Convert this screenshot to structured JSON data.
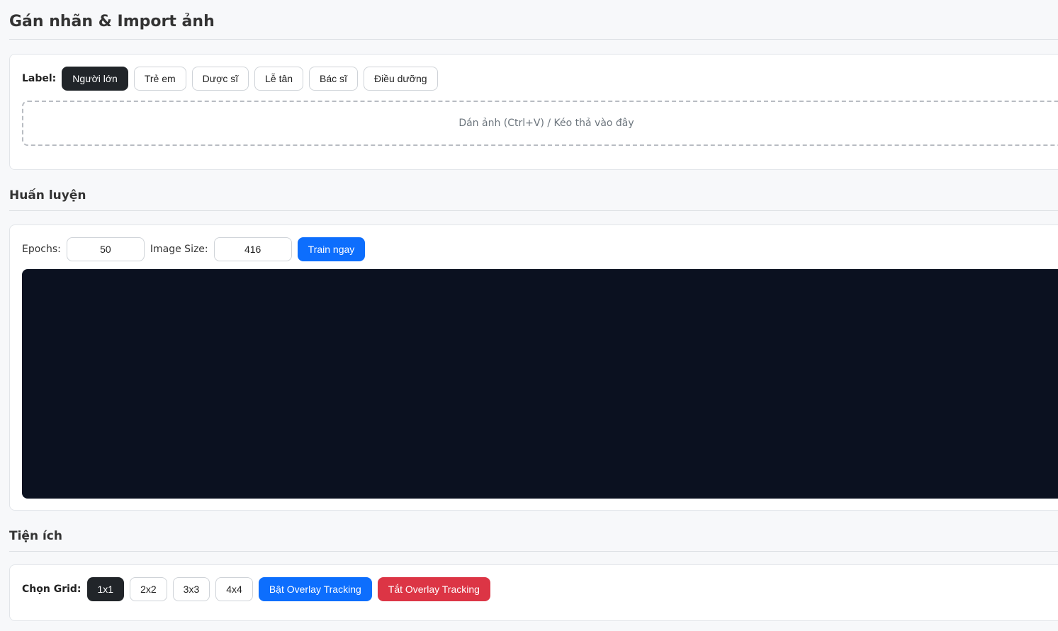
{
  "import_section": {
    "title": "Gán nhãn & Import ảnh",
    "label_prefix": "Label:",
    "labels": [
      "Người lớn",
      "Trẻ em",
      "Dược sĩ",
      "Lễ tân",
      "Bác sĩ",
      "Điều dưỡng"
    ],
    "active_label": "Người lớn",
    "dropzone_text": "Dán ảnh (Ctrl+V) / Kéo thả vào đây"
  },
  "train_section": {
    "title": "Huấn luyện",
    "epochs_label": "Epochs:",
    "epochs_value": "50",
    "image_size_label": "Image Size:",
    "image_size_value": "416",
    "train_button": "Train ngay",
    "console_bg": "#0b1120"
  },
  "utils_section": {
    "title": "Tiện ích",
    "grid_label": "Chọn Grid:",
    "grids": [
      "1x1",
      "2x2",
      "3x3",
      "4x4"
    ],
    "active_grid": "1x1",
    "overlay_on": "Bật Overlay Tracking",
    "overlay_off": "Tắt Overlay Tracking"
  },
  "colors": {
    "primary": "#0d6efd",
    "danger": "#dc3545",
    "dark": "#212529"
  }
}
